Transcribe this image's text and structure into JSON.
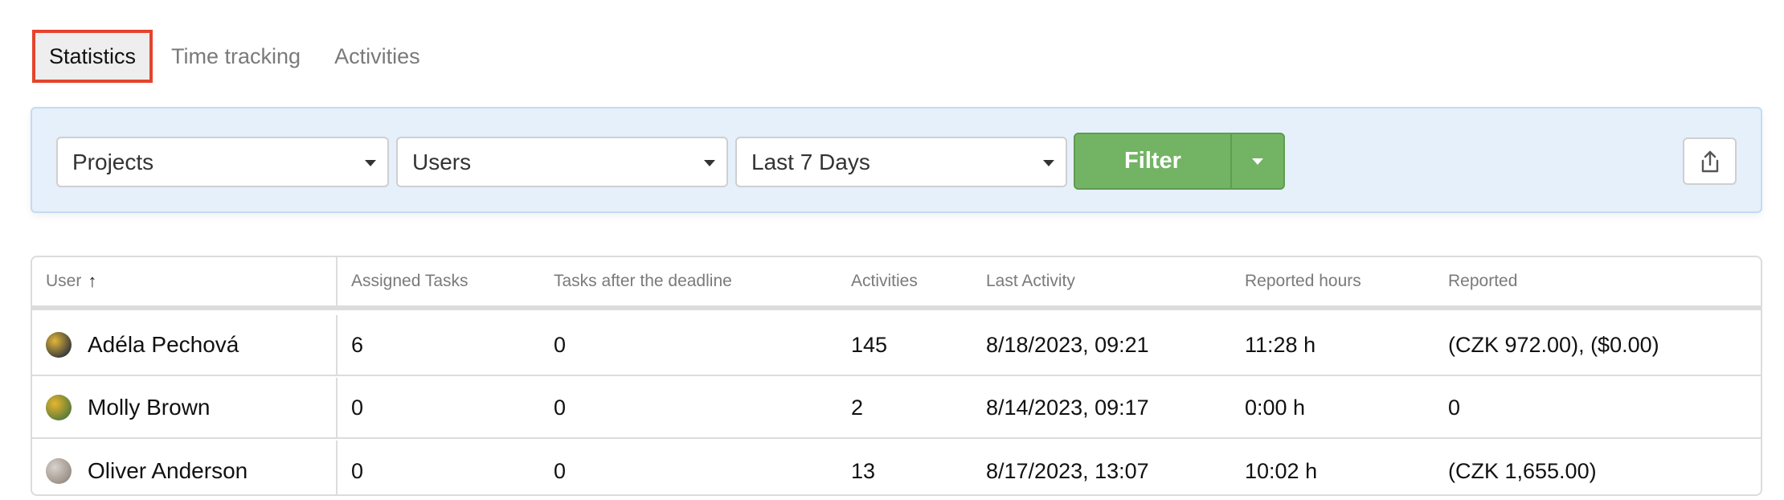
{
  "tabs": [
    {
      "label": "Statistics",
      "active": true
    },
    {
      "label": "Time tracking",
      "active": false
    },
    {
      "label": "Activities",
      "active": false
    }
  ],
  "filters": {
    "projects": {
      "value": "Projects"
    },
    "users": {
      "value": "Users"
    },
    "period": {
      "value": "Last 7 Days"
    },
    "filter_button": "Filter",
    "export_icon": "share-export-icon"
  },
  "colors": {
    "active_tab_outline": "#e5442c",
    "filter_panel_bg": "#e6f0fb",
    "filter_button": "#72b464"
  },
  "table": {
    "columns": [
      {
        "label": "User",
        "sort": "ascending"
      },
      {
        "label": "Assigned Tasks"
      },
      {
        "label": "Tasks after the deadline"
      },
      {
        "label": "Activities"
      },
      {
        "label": "Last Activity"
      },
      {
        "label": "Reported hours"
      },
      {
        "label": "Reported"
      }
    ],
    "sort_icon": "↑",
    "rows": [
      {
        "user": "Adéla Pechová",
        "avatar_colors": [
          "#3a3a3a",
          "#e2b63a"
        ],
        "assigned": "6",
        "after_deadline": "0",
        "activities": "145",
        "last_activity": "8/18/2023, 09:21",
        "reported_hours": "11:28 h",
        "reported": "(CZK 972.00), ($0.00)"
      },
      {
        "user": "Molly Brown",
        "avatar_colors": [
          "#5b7b3a",
          "#e8b52f"
        ],
        "assigned": "0",
        "after_deadline": "0",
        "activities": "2",
        "last_activity": "8/14/2023, 09:17",
        "reported_hours": "0:00 h",
        "reported": "0"
      },
      {
        "user": "Oliver Anderson",
        "avatar_colors": [
          "#9a8f86",
          "#d7d2cc"
        ],
        "assigned": "0",
        "after_deadline": "0",
        "activities": "13",
        "last_activity": "8/17/2023, 13:07",
        "reported_hours": "10:02 h",
        "reported": "(CZK 1,655.00)"
      }
    ]
  }
}
